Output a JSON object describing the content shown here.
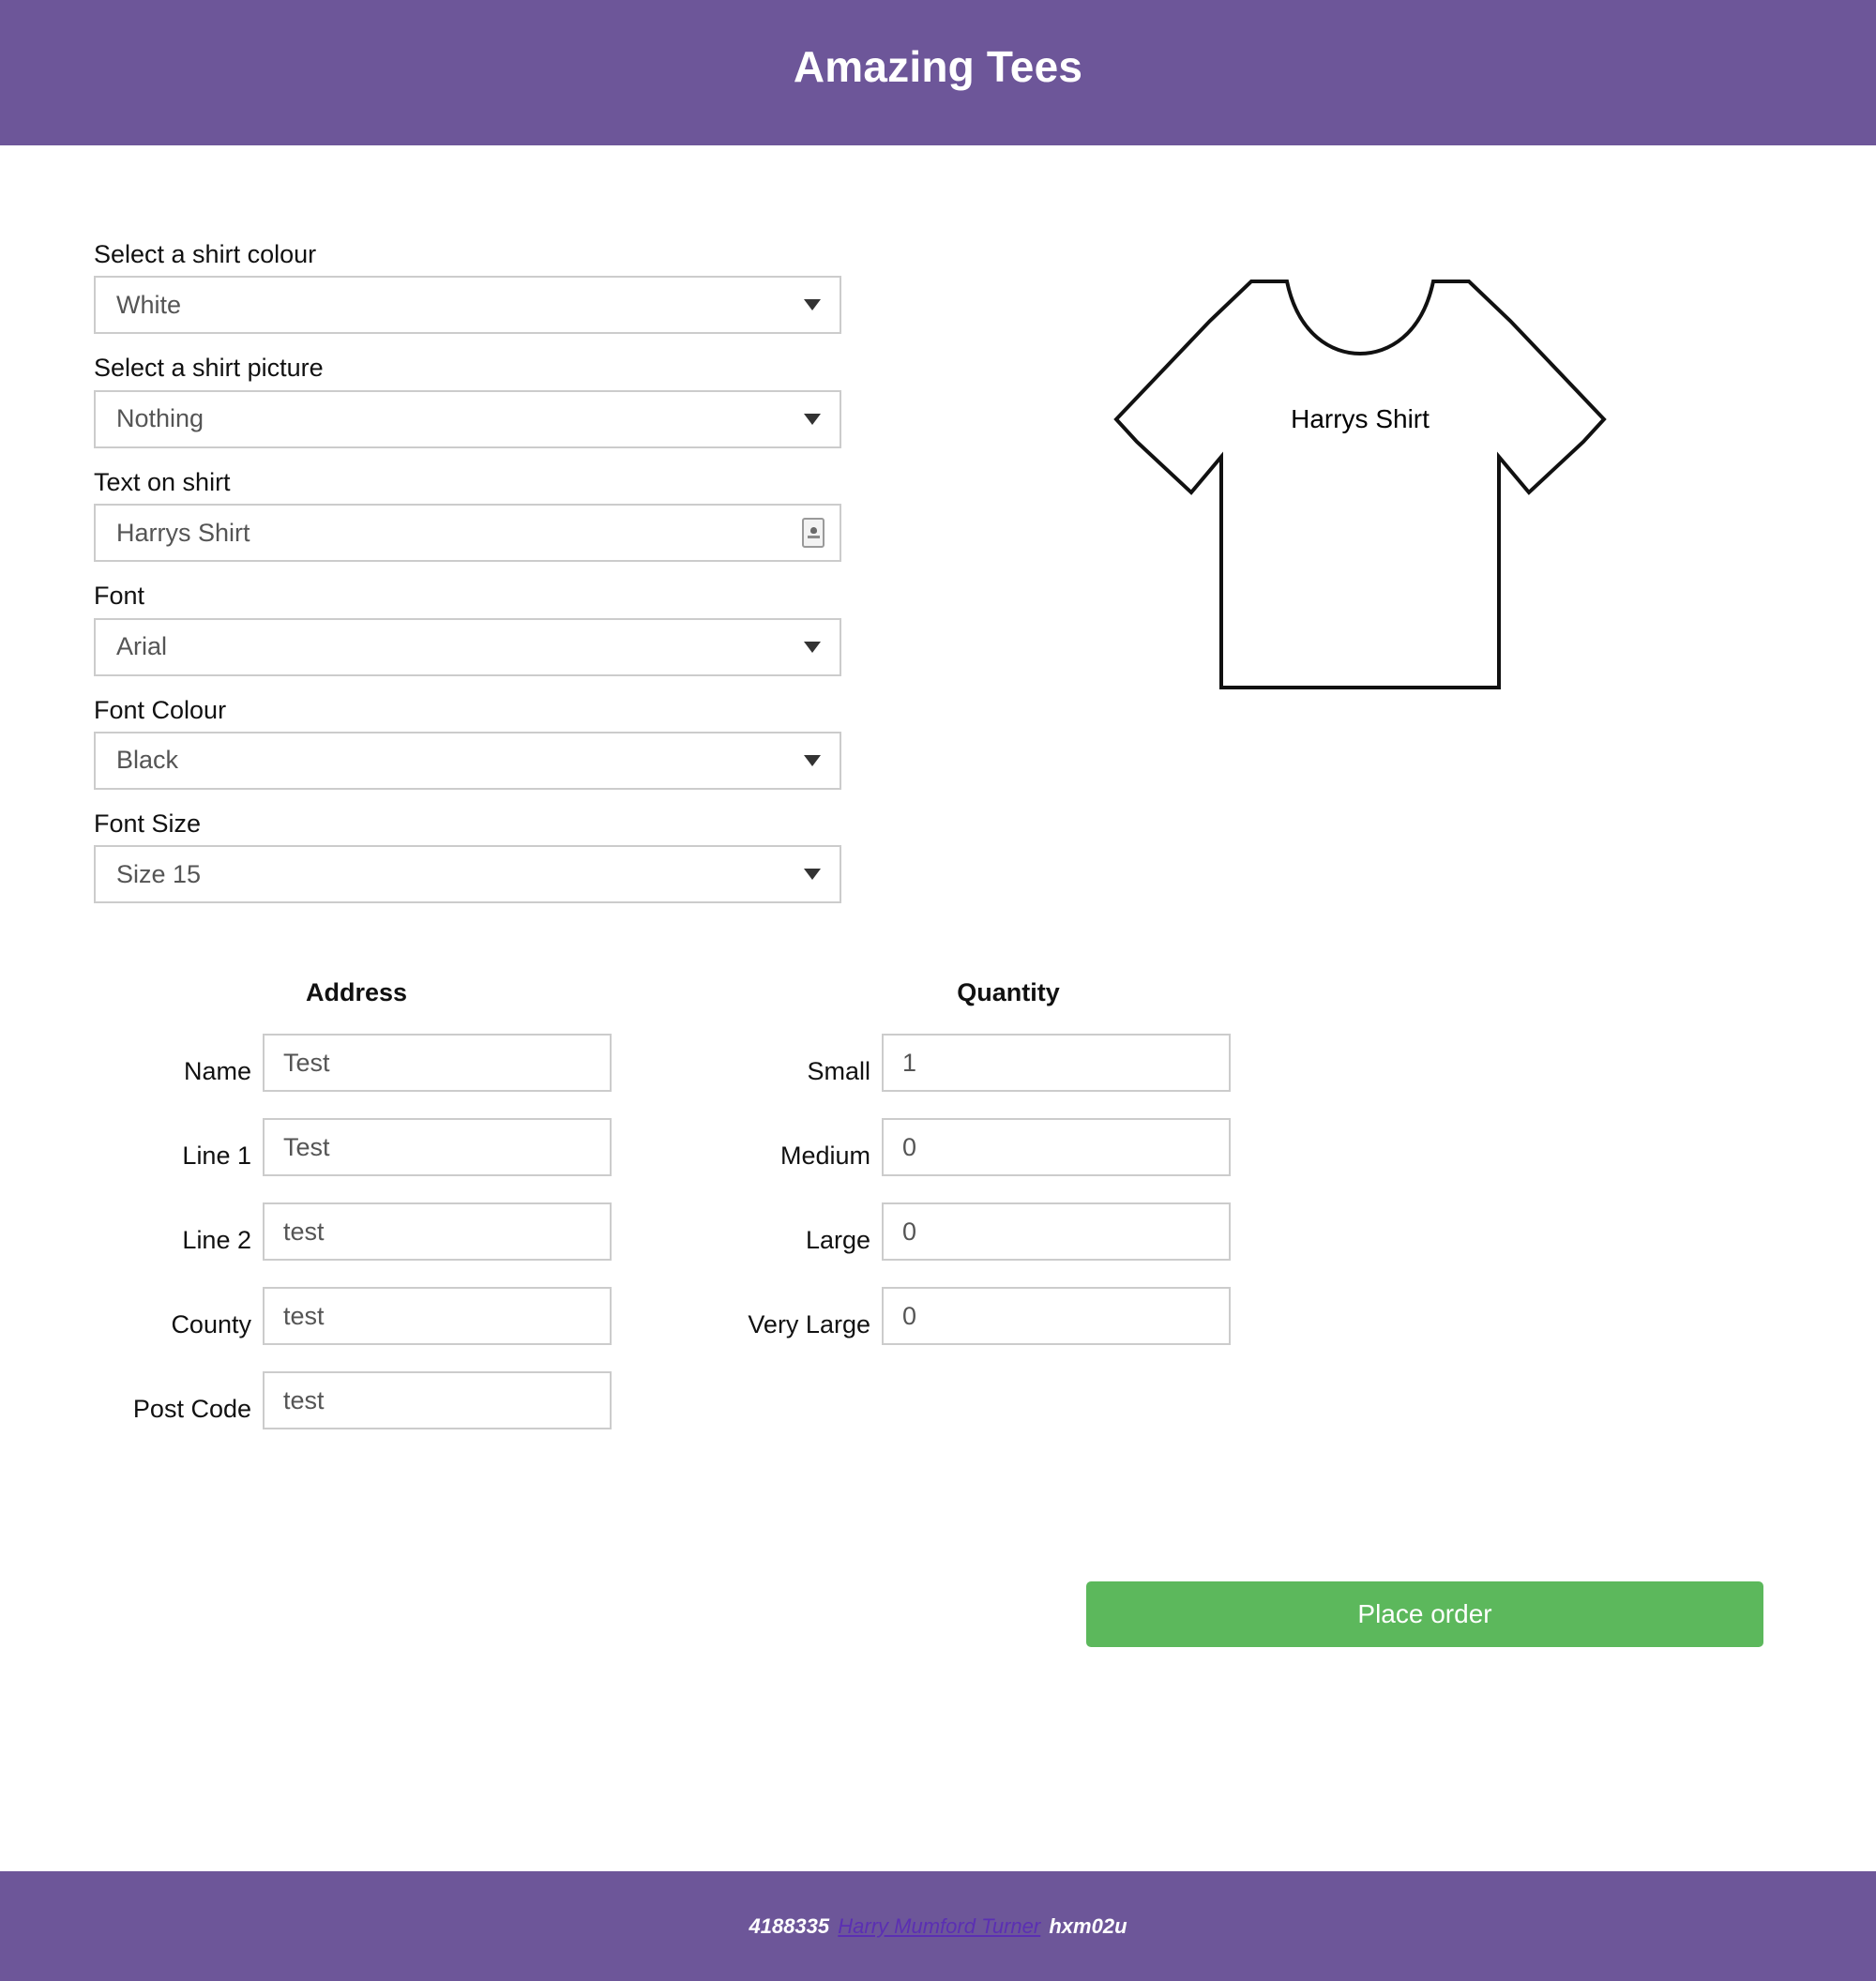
{
  "header": {
    "title": "Amazing Tees",
    "bar_color": "#6d5699"
  },
  "builder": {
    "shirt_colour": {
      "label": "Select a shirt colour",
      "value": "White"
    },
    "shirt_picture": {
      "label": "Select a shirt picture",
      "value": "Nothing"
    },
    "shirt_text": {
      "label": "Text on shirt",
      "value": "Harrys Shirt"
    },
    "font": {
      "label": "Font",
      "value": "Arial"
    },
    "font_colour": {
      "label": "Font Colour",
      "value": "Black"
    },
    "font_size": {
      "label": "Font Size",
      "value": "Size 15"
    }
  },
  "preview": {
    "shirt_text": "Harrys Shirt",
    "shirt_fill": "#ffffff",
    "outline_color": "#111111",
    "text_color": "#000000"
  },
  "address": {
    "heading": "Address",
    "rows": [
      {
        "label": "Name",
        "value": "Test"
      },
      {
        "label": "Line 1",
        "value": "Test"
      },
      {
        "label": "Line 2",
        "value": "test"
      },
      {
        "label": "County",
        "value": "test"
      },
      {
        "label": "Post Code",
        "value": "test"
      }
    ]
  },
  "quantity": {
    "heading": "Quantity",
    "rows": [
      {
        "label": "Small",
        "value": "1"
      },
      {
        "label": "Medium",
        "value": "0"
      },
      {
        "label": "Large",
        "value": "0"
      },
      {
        "label": "Very Large",
        "value": "0"
      }
    ]
  },
  "actions": {
    "place_order_label": "Place order",
    "place_order_color": "#5cb85c"
  },
  "footer": {
    "student_id": "4188335",
    "author_link": "Harry Mumford Turner",
    "username": "hxm02u",
    "link_color": "#5b2fb3"
  }
}
